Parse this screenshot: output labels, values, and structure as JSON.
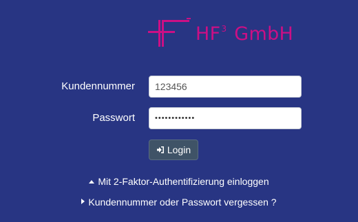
{
  "brand": {
    "name_main": "HF",
    "name_sup": "3",
    "name_rest": " GmbH",
    "color": "#cc0f85",
    "logo_icon": "hf-logo-mark"
  },
  "form": {
    "customer_label": "Kundennummer",
    "customer_value": "123456",
    "password_label": "Passwort",
    "password_value": "••••••••••••",
    "login_label": "Login",
    "login_icon": "sign-in-icon"
  },
  "links": {
    "two_factor": "Mit 2-Faktor-Authentifizierung einloggen",
    "two_factor_icon": "caret-up-icon",
    "forgot": "Kundennummer oder Passwort vergessen ?",
    "forgot_icon": "caret-right-icon"
  },
  "colors": {
    "background": "#283583",
    "button": "#3f5367"
  }
}
